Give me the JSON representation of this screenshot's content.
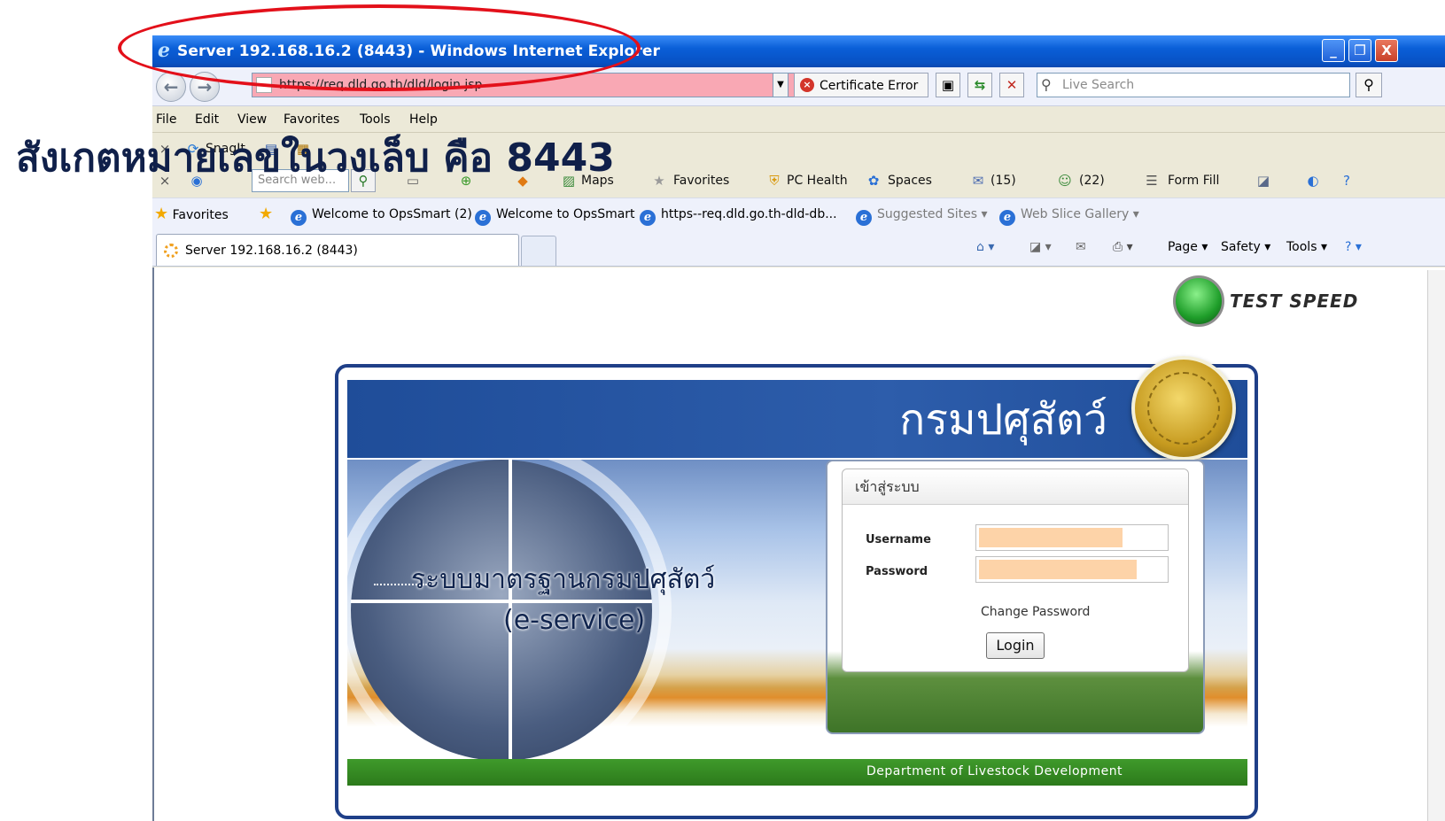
{
  "window": {
    "title": "Server 192.168.16.2 (8443) - Windows Internet Explorer",
    "buttons": [
      "_",
      "❐",
      "X"
    ]
  },
  "address_bar": {
    "url": "https://req.dld.go.th/dld/login.jsp",
    "certificate_error": "Certificate Error",
    "search_placeholder": "Live Search"
  },
  "menu": [
    "File",
    "Edit",
    "View",
    "Favorites",
    "Tools",
    "Help"
  ],
  "toolbar1": {
    "snagit": "SnagIt"
  },
  "toolbar2": {
    "search_placeholder": "Search web...",
    "maps": "Maps",
    "favorites": "Favorites",
    "pc_health": "PC Health",
    "spaces": "Spaces",
    "mail_count": "(15)",
    "contacts_count": "(22)",
    "form_fill": "Form Fill"
  },
  "favorites_bar": {
    "label": "Favorites",
    "items": [
      "Welcome to OpsSmart (2)",
      "Welcome to OpsSmart",
      "https--req.dld.go.th-dld-db...",
      "Suggested Sites ▾",
      "Web Slice Gallery ▾"
    ]
  },
  "tab": {
    "title": "Server 192.168.16.2 (8443)"
  },
  "command_bar": {
    "page": "Page ▾",
    "safety": "Safety ▾",
    "tools": "Tools ▾"
  },
  "page": {
    "test_speed": "TEST SPEED",
    "banner_title": "กรมปศุสัตว์",
    "slogan_line1": "ระบบมาตรฐานกรมปศุสัตว์",
    "slogan_line2": "(e-service)",
    "footer": "Department of Livestock Development",
    "login": {
      "heading": "เข้าสู่ระบบ",
      "username_label": "Username",
      "password_label": "Password",
      "username_value": "",
      "password_value": "",
      "change_password": "Change Password",
      "login_button": "Login"
    }
  },
  "annotation": {
    "caption": "สังเกตหมายเลขในวงเล็บ คือ 8443",
    "ellipse_color": "#e3101a"
  }
}
